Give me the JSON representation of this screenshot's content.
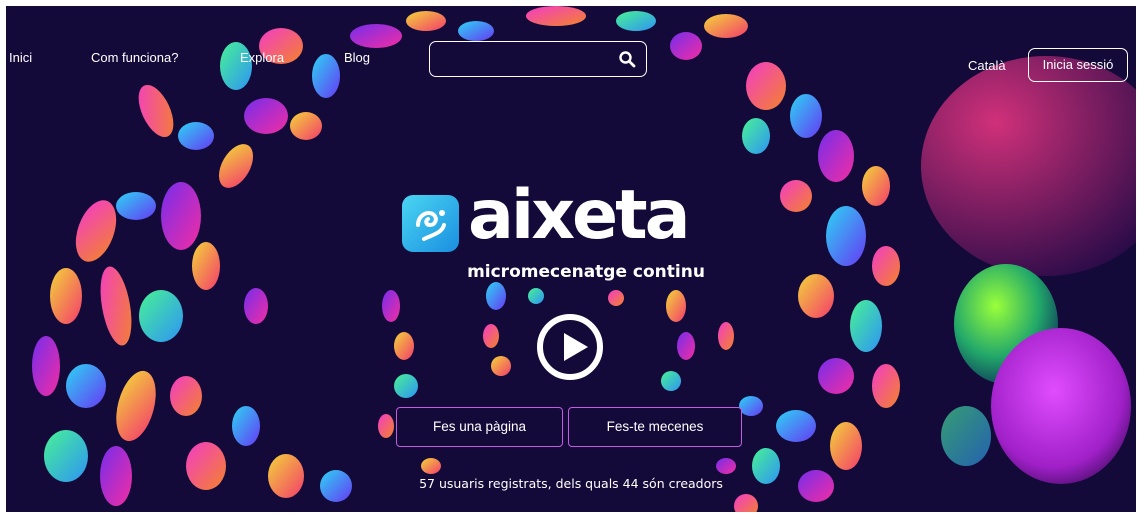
{
  "nav": {
    "items": [
      {
        "label": "Inici"
      },
      {
        "label": "Com funciona?"
      },
      {
        "label": "Explora"
      },
      {
        "label": "Blog"
      }
    ],
    "language": "Català",
    "login": "Inicia sessió"
  },
  "search": {
    "value": "",
    "placeholder": ""
  },
  "brand": {
    "name": "aixeta",
    "tagline": "micromecenatge continu"
  },
  "hero": {
    "buttons": [
      "Fes una pàgina",
      "Fes-te mecenes"
    ],
    "stats": "57 usuaris registrats, dels quals 44 són creadors"
  },
  "colors": {
    "background": "#140a3a",
    "button_border": "#c25ce0",
    "logo_icon": "#2bb4ea"
  },
  "icons": [
    "search-icon",
    "play-icon",
    "aixeta-logo-icon"
  ]
}
